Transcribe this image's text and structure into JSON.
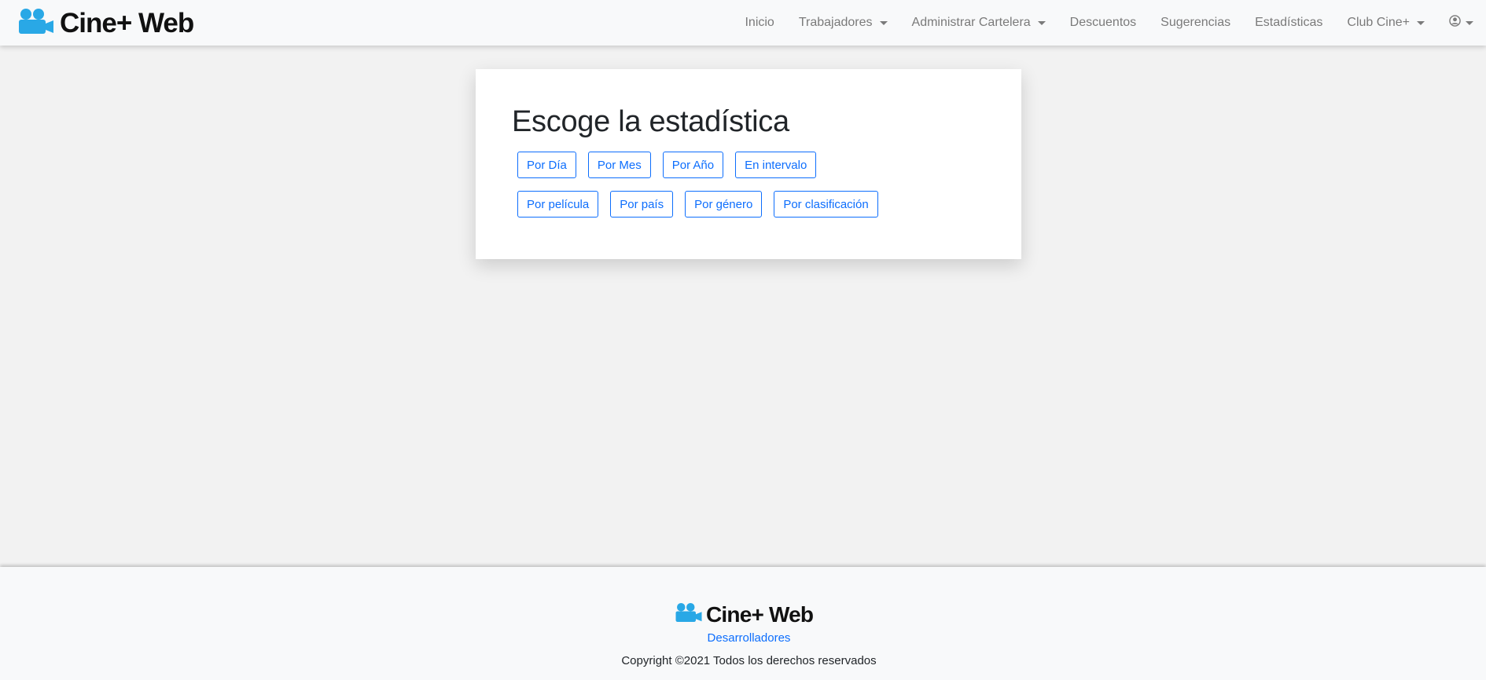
{
  "brand": {
    "name": "Cine+ Web",
    "icon": "users-icon",
    "icon_color": "#29a8e6"
  },
  "nav": {
    "items": [
      {
        "label": "Inicio",
        "dropdown": false
      },
      {
        "label": "Trabajadores",
        "dropdown": true
      },
      {
        "label": "Administrar Cartelera",
        "dropdown": true
      },
      {
        "label": "Descuentos",
        "dropdown": false
      },
      {
        "label": "Sugerencias",
        "dropdown": false
      },
      {
        "label": "Estadísticas",
        "dropdown": false
      },
      {
        "label": "Club Cine+",
        "dropdown": true
      }
    ],
    "user_icon": "user-circle-icon"
  },
  "card": {
    "title": "Escoge la estadística",
    "row1": [
      "Por Día",
      "Por Mes",
      "Por Año",
      "En intervalo"
    ],
    "row2": [
      "Por película",
      "Por país",
      "Por género",
      "Por clasificación"
    ]
  },
  "footer": {
    "brand_name": "Cine+ Web",
    "link": "Desarrolladores",
    "copyright": "Copyright ©2021 Todos los derechos reservados"
  },
  "colors": {
    "accent": "#0d6efd",
    "background": "#f2f2f2",
    "navbar": "#f8f9fa",
    "nav_text": "#7a7a7a"
  }
}
